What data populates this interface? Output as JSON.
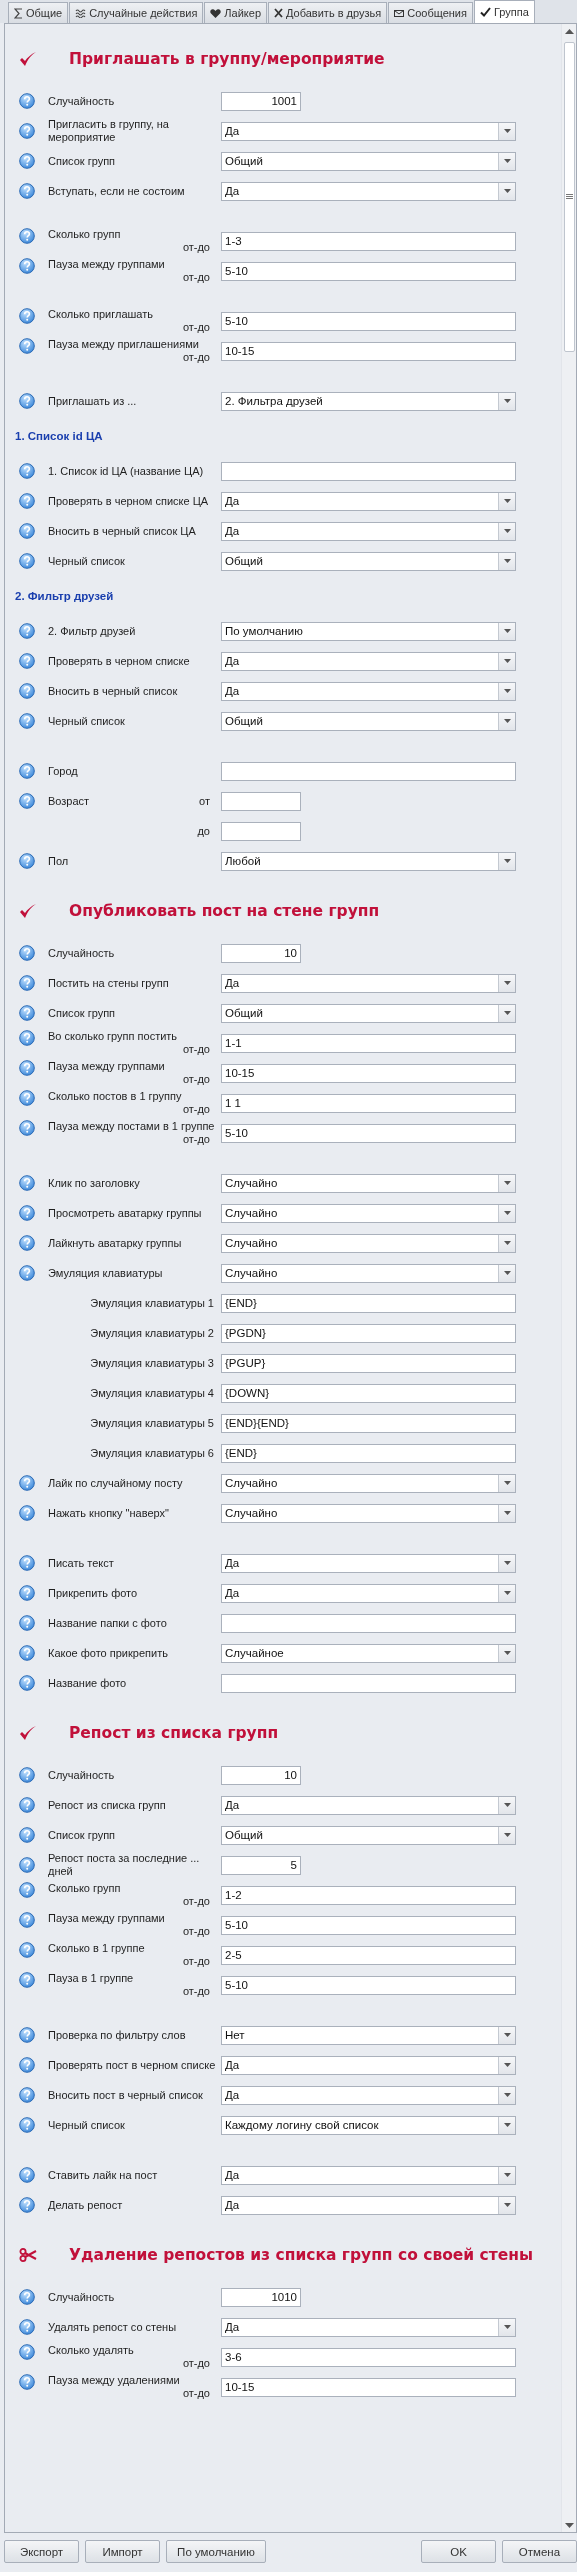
{
  "tabs": [
    {
      "label": "Общие",
      "selected": false
    },
    {
      "label": "Случайные действия",
      "selected": false
    },
    {
      "label": "Лайкер",
      "selected": false
    },
    {
      "label": "Добавить в друзья",
      "selected": false
    },
    {
      "label": "Сообщения",
      "selected": false
    },
    {
      "label": "Группа",
      "selected": true
    }
  ],
  "sections": [
    {
      "title": "Приглашать в группу/мероприятие",
      "rows": [
        {
          "kind": "number",
          "help": true,
          "label": "Случайность",
          "value": "1001"
        },
        {
          "kind": "select",
          "help": true,
          "label": "Пригласить в группу, на мероприятие",
          "value": "Да"
        },
        {
          "kind": "select",
          "help": true,
          "label": "Список групп",
          "value": "Общий"
        },
        {
          "kind": "select",
          "help": true,
          "label": "Вступать, если не состоим",
          "value": "Да"
        },
        {
          "kind": "range",
          "help": true,
          "gap": true,
          "label": "Сколько групп",
          "suffix": "от-до",
          "value": "1-3"
        },
        {
          "kind": "range",
          "help": true,
          "label": "Пауза между группами",
          "suffix": "от-до",
          "value": "5-10"
        },
        {
          "kind": "range",
          "help": true,
          "gap": true,
          "label": "Сколько приглашать",
          "suffix": "от-до",
          "value": "5-10"
        },
        {
          "kind": "range",
          "help": true,
          "label": "Пауза между приглашениями",
          "suffix": "от-до",
          "value": "10-15"
        },
        {
          "kind": "select",
          "help": true,
          "gap": true,
          "label": "Приглашать из ...",
          "value": "2. Фильтра друзей"
        },
        {
          "kind": "subheading",
          "label": "1. Список id ЦА"
        },
        {
          "kind": "text",
          "help": true,
          "label": "1. Список id ЦА (название ЦА)"
        },
        {
          "kind": "select",
          "help": true,
          "label": "Проверять в черном списке ЦА",
          "value": "Да"
        },
        {
          "kind": "select",
          "help": true,
          "label": "Вносить в черный список ЦА",
          "value": "Да"
        },
        {
          "kind": "select",
          "help": true,
          "label": "Черный список",
          "value": "Общий"
        },
        {
          "kind": "subheading",
          "label": "2. Фильтр друзей"
        },
        {
          "kind": "select",
          "help": true,
          "label": "2. Фильтр друзей",
          "value": "По умолчанию"
        },
        {
          "kind": "select",
          "help": true,
          "label": "Проверять в черном списке",
          "value": "Да"
        },
        {
          "kind": "select",
          "help": true,
          "label": "Вносить в черный список",
          "value": "Да"
        },
        {
          "kind": "select",
          "help": true,
          "label": "Черный список",
          "value": "Общий"
        },
        {
          "kind": "text",
          "help": true,
          "gap": true,
          "label": "Город"
        },
        {
          "kind": "small",
          "help": true,
          "label": "Возраст",
          "suffix": "от"
        },
        {
          "kind": "small",
          "help": false,
          "suffix": "до"
        },
        {
          "kind": "select",
          "help": true,
          "label": "Пол",
          "value": "Любой"
        }
      ]
    },
    {
      "title": "Опубликовать пост на стене групп",
      "rows": [
        {
          "kind": "number",
          "help": true,
          "label": "Случайность",
          "value": "10"
        },
        {
          "kind": "select",
          "help": true,
          "label": "Постить на стены групп",
          "value": "Да"
        },
        {
          "kind": "select",
          "help": true,
          "label": "Список групп",
          "value": "Общий"
        },
        {
          "kind": "range",
          "help": true,
          "label": "Во сколько групп постить",
          "suffix": "от-до",
          "value": "1-1"
        },
        {
          "kind": "range",
          "help": true,
          "label": "Пауза между группами",
          "suffix": "от-до",
          "value": "10-15"
        },
        {
          "kind": "range",
          "help": true,
          "label": "Сколько постов в 1 группу",
          "suffix": "от-до",
          "value": "1 1"
        },
        {
          "kind": "range",
          "help": true,
          "label": "Пауза между постами в 1 группе",
          "suffix": "от-до",
          "value": "5-10"
        },
        {
          "kind": "select",
          "help": true,
          "gap": true,
          "label": "Клик по заголовку",
          "value": "Случайно"
        },
        {
          "kind": "select",
          "help": true,
          "label": "Просмотреть аватарку группы",
          "value": "Случайно"
        },
        {
          "kind": "select",
          "help": true,
          "label": "Лайкнуть аватарку группы",
          "value": "Случайно"
        },
        {
          "kind": "select",
          "help": true,
          "label": "Эмуляция клавиатуры",
          "value": "Случайно"
        },
        {
          "kind": "text",
          "help": false,
          "label": "Эмуляция клавиатуры 1",
          "value": "{END}"
        },
        {
          "kind": "text",
          "help": false,
          "label": "Эмуляция клавиатуры 2",
          "value": "{PGDN}"
        },
        {
          "kind": "text",
          "help": false,
          "label": "Эмуляция клавиатуры 3",
          "value": "{PGUP}"
        },
        {
          "kind": "text",
          "help": false,
          "label": "Эмуляция клавиатуры 4",
          "value": "{DOWN}"
        },
        {
          "kind": "text",
          "help": false,
          "label": "Эмуляция клавиатуры 5",
          "value": "{END}{END}"
        },
        {
          "kind": "text",
          "help": false,
          "label": "Эмуляция клавиатуры 6",
          "value": "{END}"
        },
        {
          "kind": "select",
          "help": true,
          "label": "Лайк по случайному посту",
          "value": "Случайно"
        },
        {
          "kind": "select",
          "help": true,
          "label": "Нажать кнопку \"наверх\"",
          "value": "Случайно"
        },
        {
          "kind": "select",
          "help": true,
          "gap": true,
          "label": "Писать текст",
          "value": "Да"
        },
        {
          "kind": "select",
          "help": true,
          "label": "Прикрепить фото",
          "value": "Да"
        },
        {
          "kind": "text",
          "help": true,
          "label": "Название папки с фото"
        },
        {
          "kind": "select",
          "help": true,
          "label": "Какое фото прикрепить",
          "value": "Случайное"
        },
        {
          "kind": "text",
          "help": true,
          "label": "Название фото"
        }
      ]
    },
    {
      "title": "Репост из списка групп",
      "rows": [
        {
          "kind": "number",
          "help": true,
          "label": "Случайность",
          "value": "10"
        },
        {
          "kind": "select",
          "help": true,
          "label": "Репост из списка групп",
          "value": "Да"
        },
        {
          "kind": "select",
          "help": true,
          "label": "Список групп",
          "value": "Общий"
        },
        {
          "kind": "number",
          "help": true,
          "label": "Репост поста за последние ... дней",
          "value": "5"
        },
        {
          "kind": "range",
          "help": true,
          "label": "Сколько групп",
          "suffix": "от-до",
          "value": "1-2"
        },
        {
          "kind": "range",
          "help": true,
          "label": "Пауза между группами",
          "suffix": "от-до",
          "value": "5-10"
        },
        {
          "kind": "range",
          "help": true,
          "label": "Сколько в 1 группе",
          "suffix": "от-до",
          "value": "2-5"
        },
        {
          "kind": "range",
          "help": true,
          "label": "Пауза в 1 группе",
          "suffix": "от-до",
          "value": "5-10"
        },
        {
          "kind": "select",
          "help": true,
          "gap": true,
          "label": "Проверка по фильтру слов",
          "value": "Нет"
        },
        {
          "kind": "select",
          "help": true,
          "label": "Проверять пост в черном списке",
          "value": "Да"
        },
        {
          "kind": "select",
          "help": true,
          "label": "Вносить пост в черный список",
          "value": "Да"
        },
        {
          "kind": "select",
          "help": true,
          "label": "Черный список",
          "value": "Каждому логину свой список"
        },
        {
          "kind": "select",
          "help": true,
          "gap": true,
          "label": "Ставить лайк на пост",
          "value": "Да"
        },
        {
          "kind": "select",
          "help": true,
          "label": "Делать репост",
          "value": "Да"
        }
      ]
    },
    {
      "title": "Удаление репостов из списка групп со своей стены",
      "rows": [
        {
          "kind": "number",
          "help": true,
          "label": "Случайность",
          "value": "1010"
        },
        {
          "kind": "select",
          "help": true,
          "label": "Удалять репост со стены",
          "value": "Да"
        },
        {
          "kind": "range",
          "help": true,
          "label": "Сколько удалять",
          "suffix": "от-до",
          "value": "3-6"
        },
        {
          "kind": "range",
          "help": true,
          "label": "Пауза между удалениями",
          "suffix": "от-до",
          "value": "10-15"
        }
      ]
    }
  ],
  "footer_left": [
    "Экспорт",
    "Импорт",
    "По умолчанию"
  ],
  "footer_right": [
    "OK",
    "Отмена"
  ]
}
